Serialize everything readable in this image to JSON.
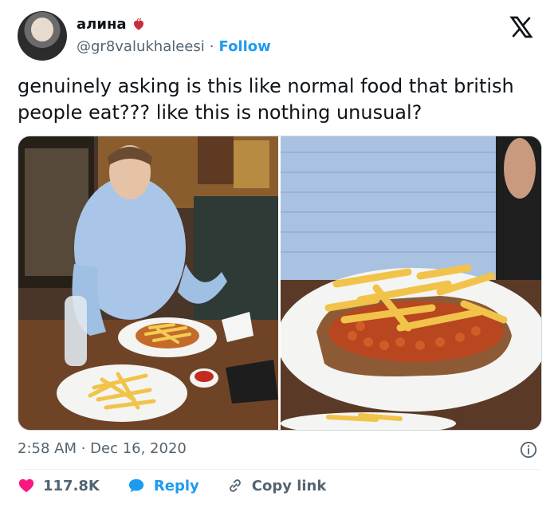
{
  "author": {
    "name": "алина",
    "handle": "@gr8valukhaleesi",
    "follow_label": "Follow",
    "separator": "·"
  },
  "tweet": {
    "text": "genuinely asking is this like normal food that british people eat??? like this is nothing unusual?",
    "timestamp": "2:58 AM · Dec 16, 2020"
  },
  "actions": {
    "likes": "117.8K",
    "reply_label": "Reply",
    "copy_label": "Copy link"
  },
  "icons": {
    "heart": "heart-icon",
    "reply": "speech-bubble-icon",
    "copy": "link-icon",
    "logo": "x-logo-icon",
    "info": "info-icon"
  },
  "colors": {
    "accent": "#1d9bf0",
    "like": "#f91880",
    "muted": "#536471",
    "text": "#0f1419"
  }
}
